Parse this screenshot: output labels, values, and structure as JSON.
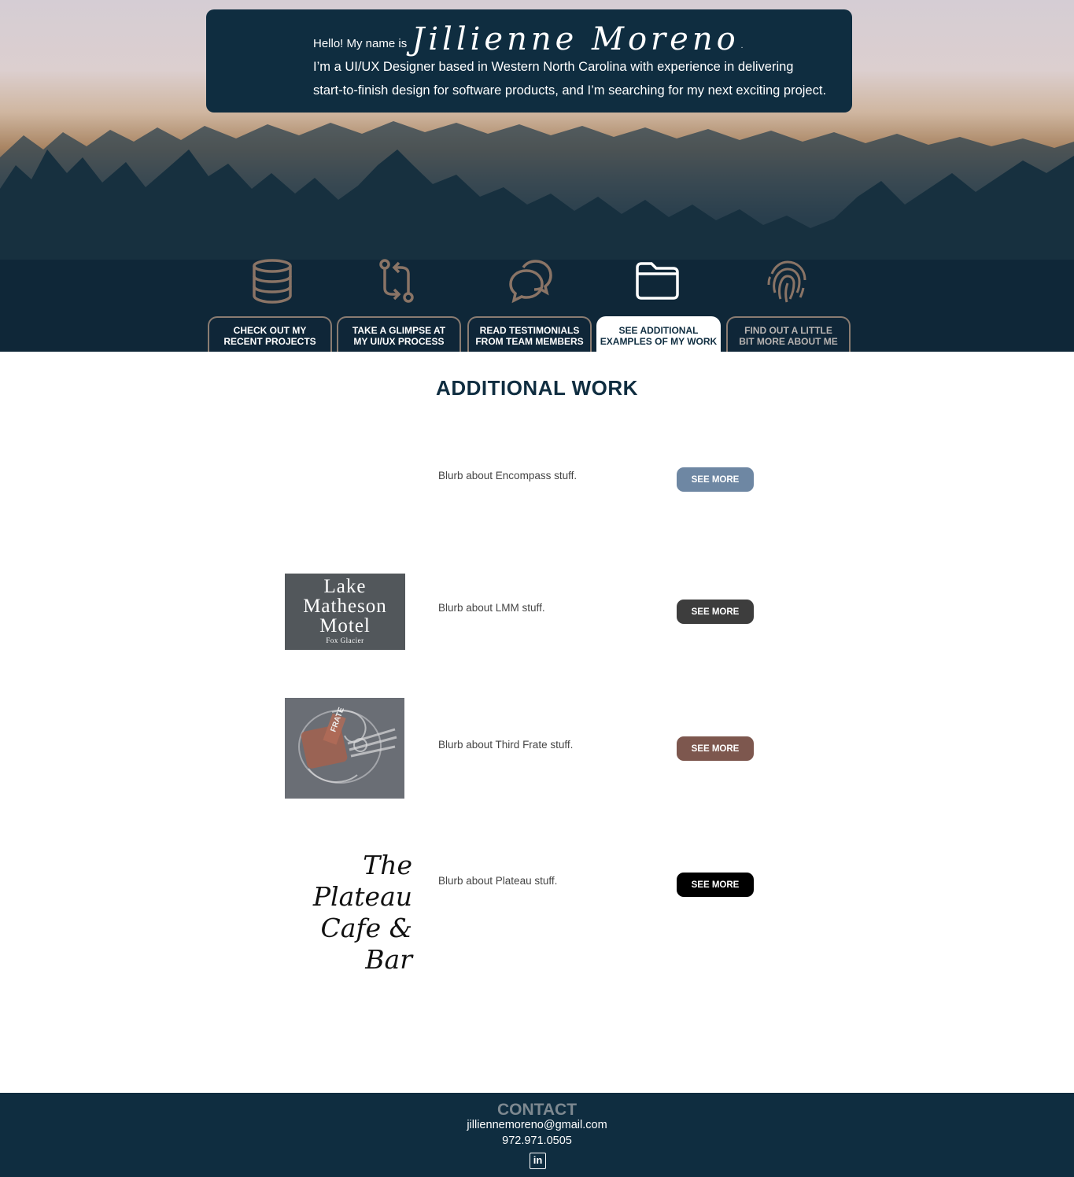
{
  "intro": {
    "hello": "Hello!  My name is",
    "name": "Jillienne Moreno",
    "dot": ".",
    "line1": "I’m a UI/UX Designer based in Western North Carolina with experience in delivering",
    "line2": "start-to-finish design for software products, and I’m searching for my next exciting project."
  },
  "nav": {
    "icons": [
      "database-icon",
      "git-compare-icon",
      "chat-bubbles-icon",
      "folder-icon",
      "fingerprint-icon"
    ],
    "tabs": [
      {
        "line1": "CHECK OUT MY",
        "line2": "RECENT PROJECTS"
      },
      {
        "line1": "TAKE A GLIMPSE AT",
        "line2": "MY UI/UX PROCESS"
      },
      {
        "line1": "READ TESTIMONIALS",
        "line2": "FROM TEAM MEMBERS"
      },
      {
        "line1": "SEE ADDITIONAL",
        "line2": "EXAMPLES OF MY WORK"
      },
      {
        "line1": "FIND OUT A LITTLE",
        "line2": "BIT MORE  ABOUT ME"
      }
    ],
    "active_tab": 3
  },
  "section": {
    "title": "ADDITIONAL WORK"
  },
  "works": [
    {
      "blurb": "Blurb about Encompass stuff.",
      "button": "SEE MORE",
      "color": "#6e87a3"
    },
    {
      "blurb": "Blurb about LMM stuff.",
      "button": "SEE MORE",
      "color": "#3d3d3d",
      "logo_lines": [
        "Lake",
        "Matheson",
        "Motel",
        "Fox Glacier"
      ]
    },
    {
      "blurb": "Blurb about Third Frate stuff.",
      "button": "SEE MORE",
      "color": "#7d574e",
      "logo_text": "FRATE"
    },
    {
      "blurb": "Blurb about Plateau stuff.",
      "button": "SEE MORE",
      "color": "#000000",
      "logo_lines": [
        "The Plateau",
        "Cafe & Bar"
      ]
    }
  ],
  "footer": {
    "title": "CONTACT",
    "email": "jilliennemoreno@gmail.com",
    "phone": "972.971.0505",
    "linkedin_label": "in"
  },
  "colors": {
    "navy": "#0f2d40",
    "tab_border": "#8a7c72",
    "icon_tan": "#8a7466"
  }
}
